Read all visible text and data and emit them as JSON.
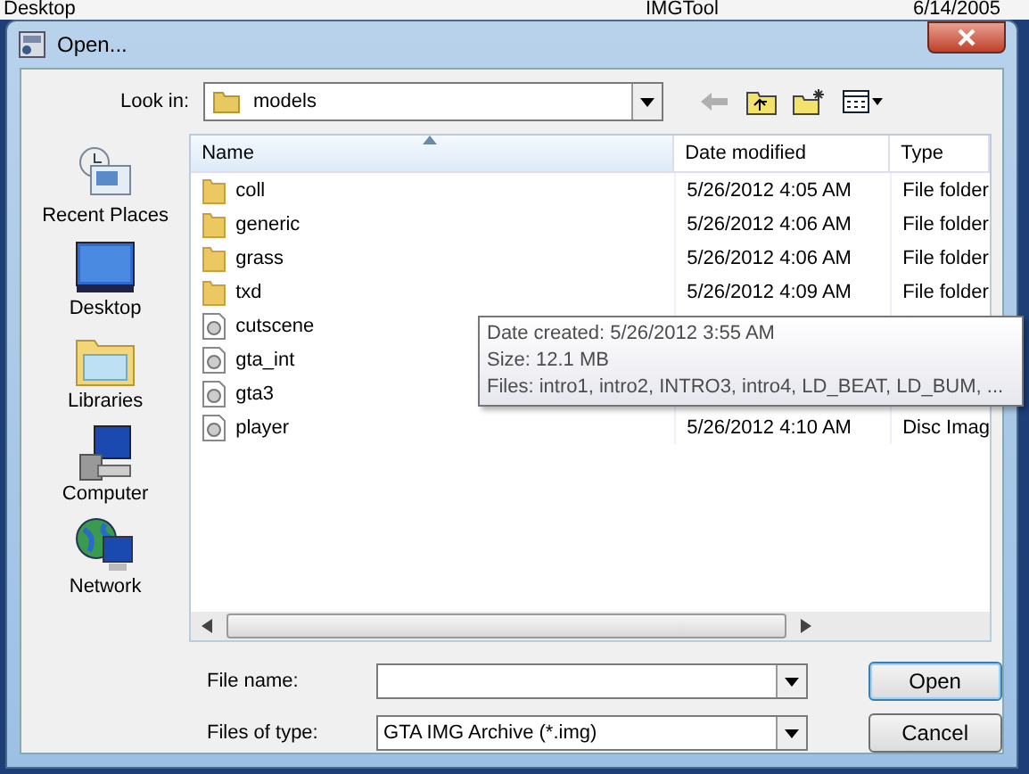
{
  "background": {
    "texts": [
      "Desktop",
      "IMGTool",
      "6/14/2005"
    ]
  },
  "window": {
    "title": "Open..."
  },
  "look_in": {
    "label": "Look in:",
    "value": "models"
  },
  "toolbar": {
    "back_disabled": true
  },
  "places": [
    {
      "kind": "recent",
      "label": "Recent Places"
    },
    {
      "kind": "desktop",
      "label": "Desktop"
    },
    {
      "kind": "libraries",
      "label": "Libraries"
    },
    {
      "kind": "computer",
      "label": "Computer"
    },
    {
      "kind": "network",
      "label": "Network"
    }
  ],
  "table": {
    "columns": [
      "Name",
      "Date modified",
      "Type"
    ],
    "rows": [
      {
        "kind": "folder",
        "name": "coll",
        "date": "5/26/2012 4:05 AM",
        "type": "File folder"
      },
      {
        "kind": "folder",
        "name": "generic",
        "date": "5/26/2012 4:06 AM",
        "type": "File folder"
      },
      {
        "kind": "folder",
        "name": "grass",
        "date": "5/26/2012 4:06 AM",
        "type": "File folder"
      },
      {
        "kind": "folder",
        "name": "txd",
        "date": "5/26/2012 4:09 AM",
        "type": "File folder"
      },
      {
        "kind": "file",
        "name": "cutscene"
      },
      {
        "kind": "file",
        "name": "gta_int"
      },
      {
        "kind": "file",
        "name": "gta3"
      },
      {
        "kind": "file",
        "name": "player",
        "date": "5/26/2012 4:10 AM",
        "type": "Disc Imag"
      }
    ]
  },
  "tooltip": [
    "Date created: 5/26/2012 3:55 AM",
    "Size: 12.1 MB",
    "Files: intro1, intro2, INTRO3, intro4, LD_BEAT, LD_BUM, ..."
  ],
  "file_name": {
    "label": "File name:"
  },
  "file_type": {
    "label": "Files of type:",
    "value": "GTA IMG Archive (*.img)"
  },
  "buttons": [
    "Open",
    "Cancel"
  ]
}
